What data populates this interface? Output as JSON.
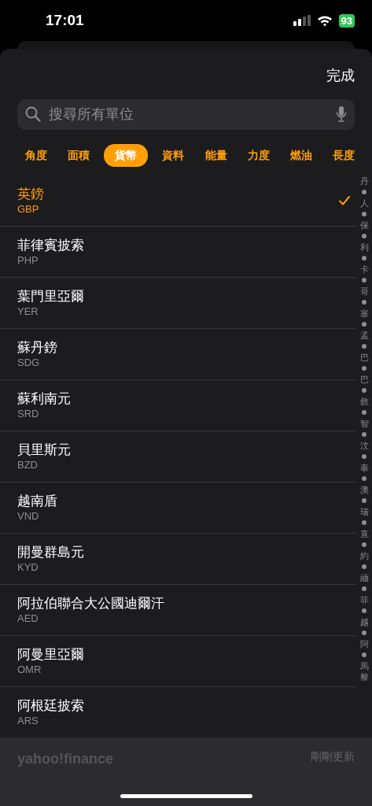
{
  "status_bar": {
    "time": "17:01",
    "battery": "93"
  },
  "done_button": "完成",
  "search": {
    "placeholder": "搜尋所有單位"
  },
  "tabs": [
    {
      "label": "角度",
      "selected": false
    },
    {
      "label": "面積",
      "selected": false
    },
    {
      "label": "貨幣",
      "selected": true
    },
    {
      "label": "資料",
      "selected": false
    },
    {
      "label": "能量",
      "selected": false
    },
    {
      "label": "力度",
      "selected": false
    },
    {
      "label": "燃油",
      "selected": false
    },
    {
      "label": "長度",
      "selected": false
    }
  ],
  "units": [
    {
      "name": "英鎊",
      "code": "GBP",
      "selected": true
    },
    {
      "name": "菲律賓披索",
      "code": "PHP",
      "selected": false
    },
    {
      "name": "葉門里亞爾",
      "code": "YER",
      "selected": false
    },
    {
      "name": "蘇丹鎊",
      "code": "SDG",
      "selected": false
    },
    {
      "name": "蘇利南元",
      "code": "SRD",
      "selected": false
    },
    {
      "name": "貝里斯元",
      "code": "BZD",
      "selected": false
    },
    {
      "name": "越南盾",
      "code": "VND",
      "selected": false
    },
    {
      "name": "開曼群島元",
      "code": "KYD",
      "selected": false
    },
    {
      "name": "阿拉伯聯合大公國迪爾汗",
      "code": "AED",
      "selected": false
    },
    {
      "name": "阿曼里亞爾",
      "code": "OMR",
      "selected": false
    },
    {
      "name": "阿根廷披索",
      "code": "ARS",
      "selected": false
    }
  ],
  "index": [
    {
      "label": "丹",
      "dot_after": true
    },
    {
      "label": "人",
      "dot_after": true
    },
    {
      "label": "保",
      "dot_after": true
    },
    {
      "label": "利",
      "dot_after": true
    },
    {
      "label": "卡",
      "dot_after": true
    },
    {
      "label": "哥",
      "dot_after": true
    },
    {
      "label": "塞",
      "dot_after": true
    },
    {
      "label": "孟",
      "dot_after": true
    },
    {
      "label": "巴",
      "dot_after": true
    },
    {
      "label": "巴",
      "dot_after": true
    },
    {
      "label": "敘",
      "dot_after": true
    },
    {
      "label": "智",
      "dot_after": true
    },
    {
      "label": "汶",
      "dot_after": true
    },
    {
      "label": "泰",
      "dot_after": true
    },
    {
      "label": "澳",
      "dot_after": true
    },
    {
      "label": "瑞",
      "dot_after": true
    },
    {
      "label": "直",
      "dot_after": true
    },
    {
      "label": "約",
      "dot_after": true
    },
    {
      "label": "緬",
      "dot_after": true
    },
    {
      "label": "菲",
      "dot_after": true
    },
    {
      "label": "越",
      "dot_after": true
    },
    {
      "label": "阿",
      "dot_after": true
    },
    {
      "label": "馬",
      "dot_after": false
    },
    {
      "label": "黎",
      "dot_after": false
    }
  ],
  "footer": {
    "logo": "yahoo!finance",
    "updated": "剛剛更新"
  }
}
